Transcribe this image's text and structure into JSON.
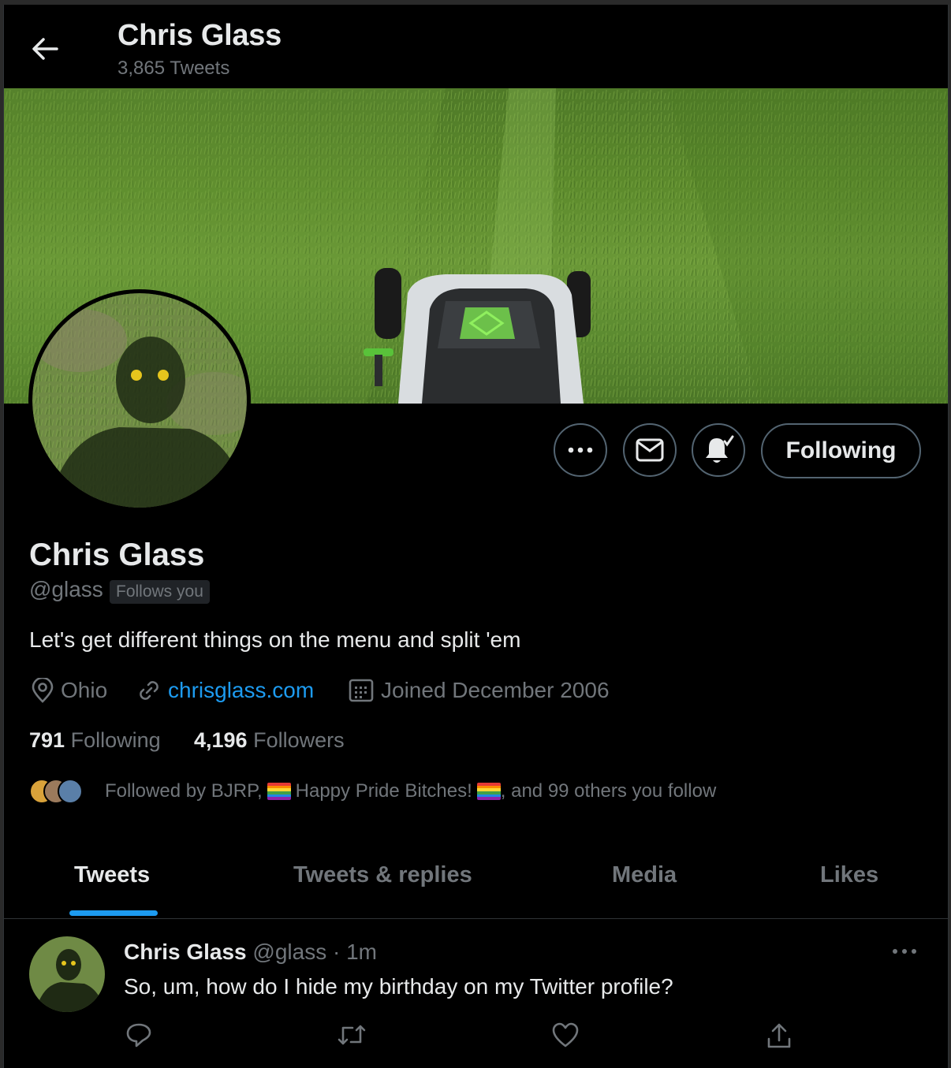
{
  "header": {
    "name": "Chris Glass",
    "tweet_count": "3,865 Tweets"
  },
  "profile": {
    "name": "Chris Glass",
    "handle": "@glass",
    "follows_you": "Follows you",
    "bio": "Let's get different things on the menu and split 'em",
    "location": "Ohio",
    "website": "chrisglass.com",
    "joined": "Joined December 2006",
    "following_count": "791",
    "following_label": "Following",
    "followers_count": "4,196",
    "followers_label": "Followers",
    "followed_by": {
      "prefix": "Followed by BJRP,",
      "middle": "Happy Pride Bitches!",
      "suffix": ", and 99 others you follow"
    }
  },
  "actions": {
    "follow_button": "Following"
  },
  "tabs": [
    "Tweets",
    "Tweets & replies",
    "Media",
    "Likes"
  ],
  "tweet": {
    "name": "Chris Glass",
    "handle": "@glass",
    "separator": "·",
    "time": "1m",
    "text": "So, um, how do I hide my birthday on my Twitter profile?"
  },
  "colors": {
    "background": "#000000",
    "text_primary": "#e7e9ea",
    "text_secondary": "#71767b",
    "accent": "#1d9bf0",
    "border": "#536471"
  },
  "icons": [
    "back-arrow-icon",
    "more-icon",
    "mail-icon",
    "notification-bell-icon",
    "location-icon",
    "link-icon",
    "calendar-icon",
    "reply-icon",
    "retweet-icon",
    "like-icon",
    "share-icon"
  ]
}
